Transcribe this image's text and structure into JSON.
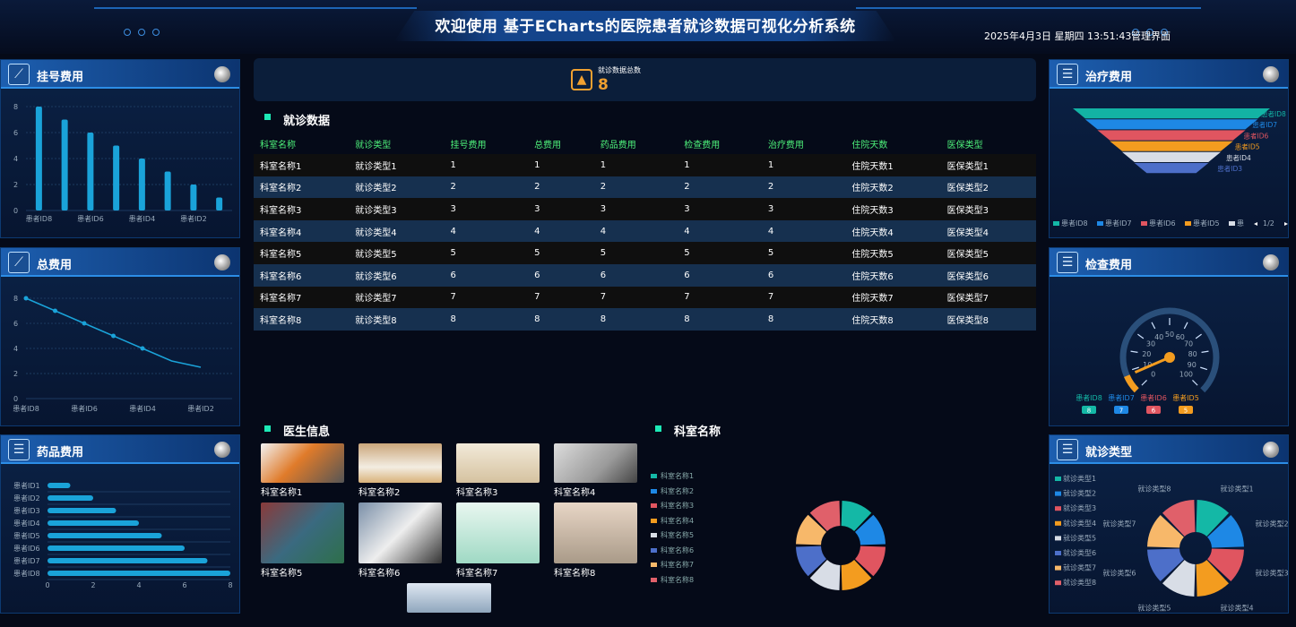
{
  "header": {
    "title": "欢迎使用 基于ECharts的医院患者就诊数据可视化分析系统",
    "datetime": "2025年4月3日 星期四 13:51:43",
    "admin_link": "管理界面"
  },
  "panels": {
    "registration": {
      "title": "挂号费用"
    },
    "total": {
      "title": "总费用"
    },
    "medicine": {
      "title": "药品费用"
    },
    "treatment": {
      "title": "治疗费用"
    },
    "examination": {
      "title": "检查费用"
    },
    "visit_type": {
      "title": "就诊类型"
    }
  },
  "summary": {
    "label": "就诊数据总数",
    "value": "8"
  },
  "visits": {
    "title": "就诊数据",
    "columns": [
      "科室名称",
      "就诊类型",
      "挂号费用",
      "总费用",
      "药品费用",
      "检查费用",
      "治疗费用",
      "住院天数",
      "医保类型"
    ],
    "rows": [
      [
        "科室名称1",
        "就诊类型1",
        "1",
        "1",
        "1",
        "1",
        "1",
        "住院天数1",
        "医保类型1"
      ],
      [
        "科室名称2",
        "就诊类型2",
        "2",
        "2",
        "2",
        "2",
        "2",
        "住院天数2",
        "医保类型2"
      ],
      [
        "科室名称3",
        "就诊类型3",
        "3",
        "3",
        "3",
        "3",
        "3",
        "住院天数3",
        "医保类型3"
      ],
      [
        "科室名称4",
        "就诊类型4",
        "4",
        "4",
        "4",
        "4",
        "4",
        "住院天数4",
        "医保类型4"
      ],
      [
        "科室名称5",
        "就诊类型5",
        "5",
        "5",
        "5",
        "5",
        "5",
        "住院天数5",
        "医保类型5"
      ],
      [
        "科室名称6",
        "就诊类型6",
        "6",
        "6",
        "6",
        "6",
        "6",
        "住院天数6",
        "医保类型6"
      ],
      [
        "科室名称7",
        "就诊类型7",
        "7",
        "7",
        "7",
        "7",
        "7",
        "住院天数7",
        "医保类型7"
      ],
      [
        "科室名称8",
        "就诊类型8",
        "8",
        "8",
        "8",
        "8",
        "8",
        "住院天数8",
        "医保类型8"
      ]
    ]
  },
  "doctors": {
    "title": "医生信息",
    "items": [
      "科室名称1",
      "科室名称2",
      "科室名称3",
      "科室名称4",
      "科室名称5",
      "科室名称6",
      "科室名称7",
      "科室名称8"
    ]
  },
  "departments": {
    "title": "科室名称"
  },
  "colors": {
    "teal": "#14b8a6",
    "blue": "#1e88e5",
    "red": "#e05560",
    "orange": "#f39c1f",
    "white": "#d8dde6",
    "steel": "#4d6fc9",
    "peach": "#f7b86a",
    "rose": "#e0606a"
  },
  "chart_data": [
    {
      "type": "bar",
      "id": "registration",
      "categories": [
        "患者ID8",
        "患者ID7",
        "患者ID6",
        "患者ID5",
        "患者ID4",
        "患者ID3",
        "患者ID2",
        "患者ID1"
      ],
      "values": [
        8,
        7,
        6,
        5,
        4,
        3,
        2,
        1
      ],
      "ylim": [
        0,
        8
      ],
      "yticks": [
        0,
        2,
        4,
        6,
        8
      ],
      "xticklabels": [
        "患者ID8",
        "患者ID6",
        "患者ID4",
        "患者ID2"
      ]
    },
    {
      "type": "line",
      "id": "total",
      "categories": [
        "患者ID8",
        "患者ID7",
        "患者ID6",
        "患者ID5",
        "患者ID4",
        "患者ID3",
        "患者ID2"
      ],
      "values": [
        8,
        7,
        6,
        5,
        4,
        3,
        2.5
      ],
      "ylim": [
        0,
        8
      ],
      "yticks": [
        0,
        2,
        4,
        6,
        8
      ],
      "xticklabels": [
        "患者ID8",
        "患者ID6",
        "患者ID4",
        "患者ID2"
      ]
    },
    {
      "type": "bar",
      "id": "medicine",
      "orientation": "horizontal",
      "categories": [
        "患者ID1",
        "患者ID2",
        "患者ID3",
        "患者ID4",
        "患者ID5",
        "患者ID6",
        "患者ID7",
        "患者ID8"
      ],
      "values": [
        1,
        2,
        3,
        4,
        5,
        6,
        7,
        8
      ],
      "xlim": [
        0,
        8
      ],
      "xticks": [
        0,
        2,
        4,
        6,
        8
      ]
    },
    {
      "type": "funnel",
      "id": "treatment",
      "categories": [
        "患者ID8",
        "患者ID7",
        "患者ID6",
        "患者ID5",
        "患者ID4",
        "患者ID3"
      ],
      "values": [
        8,
        7,
        6,
        5,
        4,
        3
      ],
      "legend": [
        "患者ID8",
        "患者ID7",
        "患者ID6",
        "患者ID5",
        "患"
      ],
      "page": "1/2"
    },
    {
      "type": "gauge",
      "id": "examination",
      "min": 0,
      "max": 100,
      "ticklabels": [
        "0",
        "10",
        "20",
        "30",
        "40",
        "50",
        "60",
        "70",
        "80",
        "90",
        "100"
      ],
      "series": [
        {
          "name": "患者ID8",
          "value": 8
        },
        {
          "name": "患者ID7",
          "value": 7
        },
        {
          "name": "患者ID6",
          "value": 6
        },
        {
          "name": "患者ID5",
          "value": 5
        }
      ]
    },
    {
      "type": "pie",
      "id": "departments",
      "categories": [
        "科室名称1",
        "科室名称2",
        "科室名称3",
        "科室名称4",
        "科室名称5",
        "科室名称6",
        "科室名称7",
        "科室名称8"
      ],
      "values": [
        1,
        1,
        1,
        1,
        1,
        1,
        1,
        1
      ]
    },
    {
      "type": "pie",
      "id": "visit_type",
      "categories": [
        "就诊类型1",
        "就诊类型2",
        "就诊类型3",
        "就诊类型4",
        "就诊类型5",
        "就诊类型6",
        "就诊类型7",
        "就诊类型8"
      ],
      "values": [
        1,
        1,
        1,
        1,
        1,
        1,
        1,
        1
      ]
    }
  ]
}
